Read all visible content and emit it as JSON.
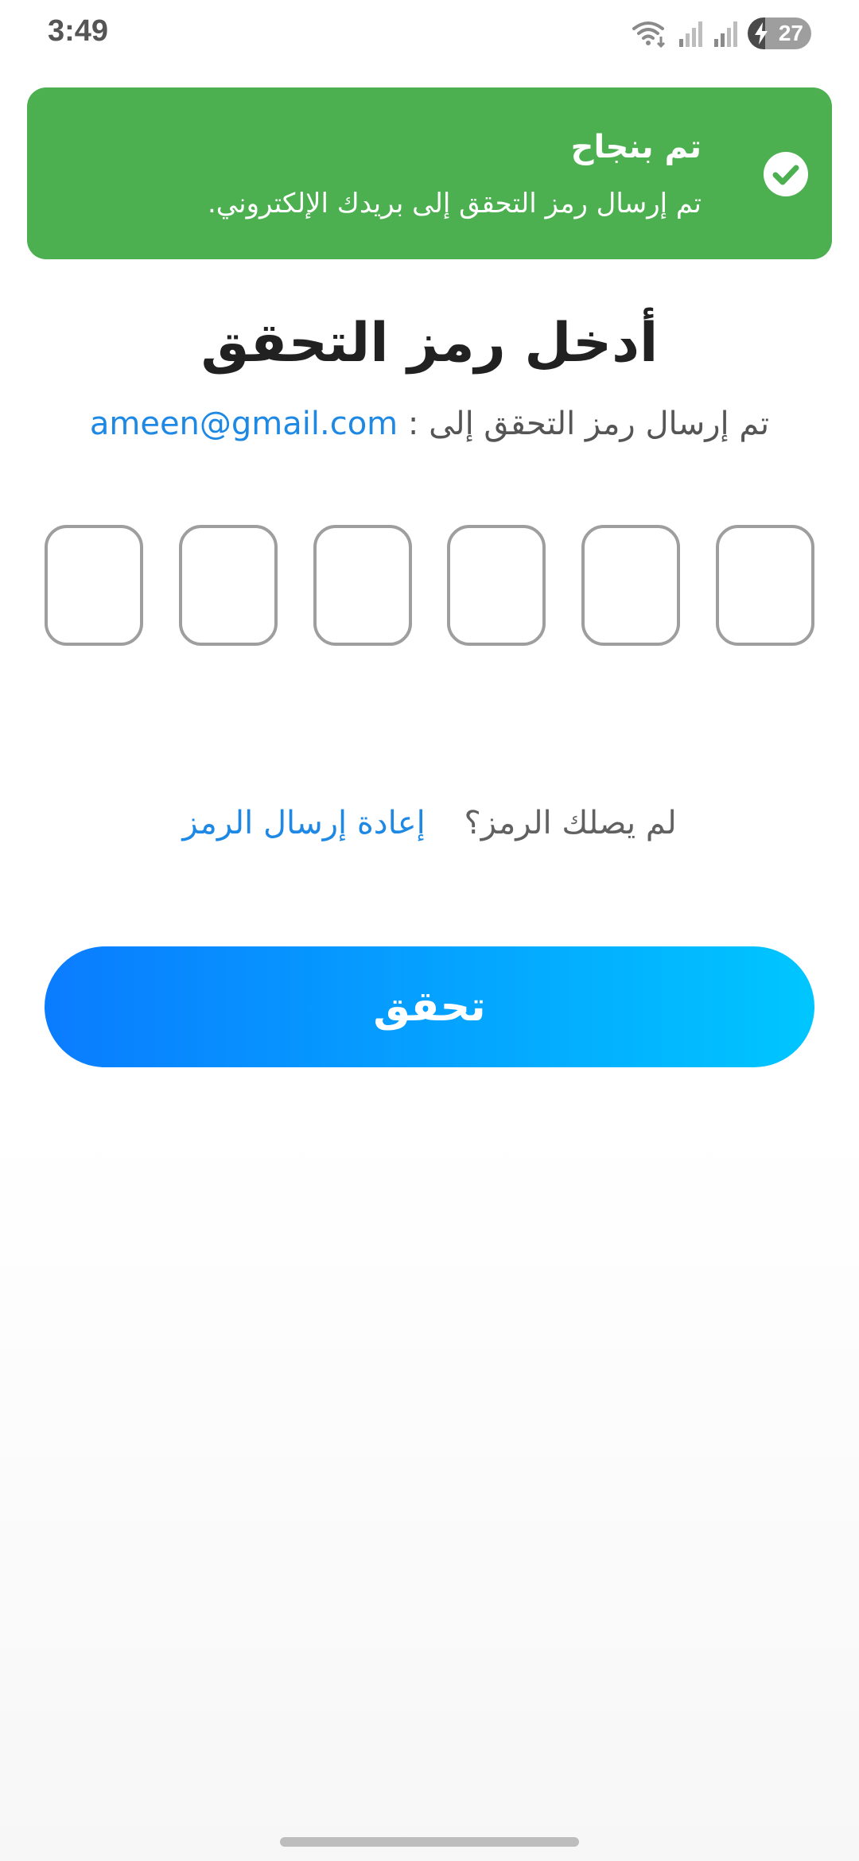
{
  "status_bar": {
    "time": "3:49",
    "battery_level": "27",
    "battery_fraction": 0.27,
    "icons": [
      "wifi-icon",
      "cellular-signal-icon",
      "cellular-signal-icon",
      "battery-charging-icon"
    ]
  },
  "toast": {
    "title": "تم بنجاح",
    "message": "تم إرسال رمز التحقق إلى بريدك الإلكتروني.",
    "icon": "check-circle-icon",
    "color": "#4caf50"
  },
  "page": {
    "title": "أدخل رمز التحقق",
    "subtitle_prefix": "تم إرسال رمز التحقق إلى :",
    "email": "ameen@gmail.com"
  },
  "otp": {
    "length": 6,
    "values": [
      "",
      "",
      "",
      "",
      "",
      ""
    ]
  },
  "resend": {
    "question": "لم يصلك الرمز؟",
    "link_label": "إعادة إرسال الرمز"
  },
  "verify_button": {
    "label": "تحقق",
    "gradient_start": "#0a7cff",
    "gradient_end": "#00c6ff"
  },
  "colors": {
    "accent": "#1e88e5",
    "success": "#4caf50",
    "text_primary": "#212121",
    "text_secondary": "#555555"
  }
}
